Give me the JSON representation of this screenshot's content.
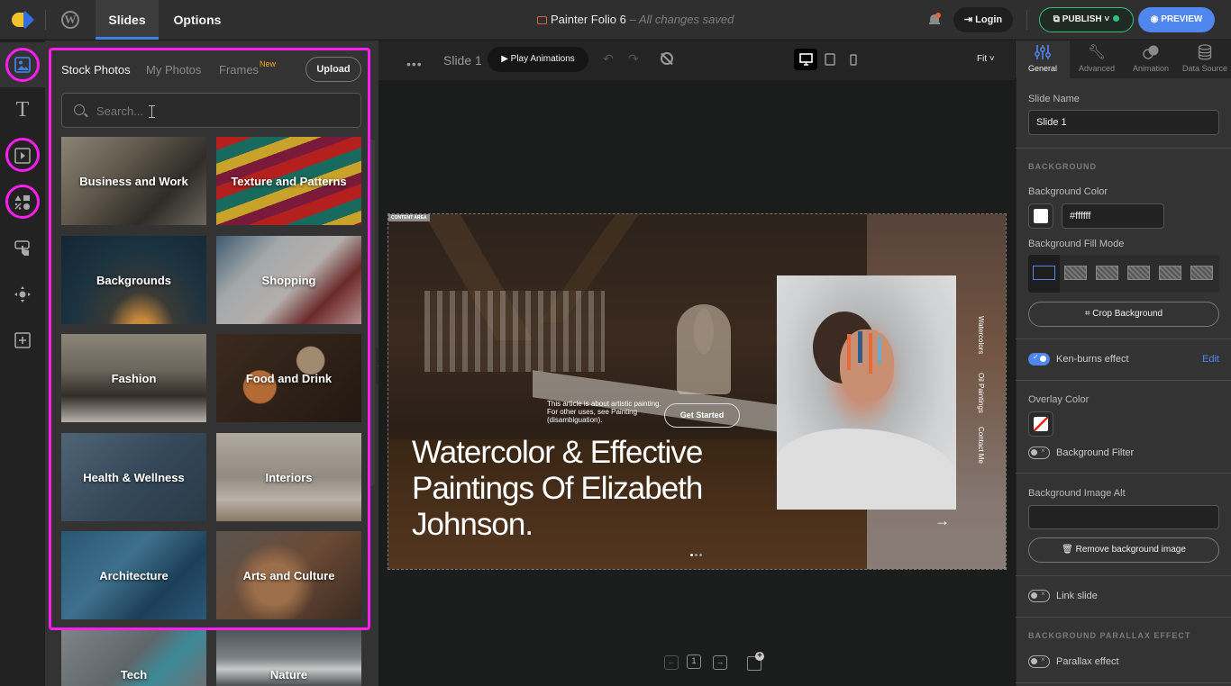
{
  "topbar": {
    "tabs": [
      {
        "label": "Slides",
        "active": true
      },
      {
        "label": "Options",
        "active": false
      }
    ],
    "project_title": "Painter Folio 6",
    "save_status": "– All changes saved",
    "login_label": "Login",
    "publish_label": "PUBLISH",
    "preview_label": "PREVIEW",
    "colors": {
      "accent": "#3f7ee8",
      "publish": "#2ec27e",
      "preview": "#4f86f0"
    }
  },
  "left_sidebar": {
    "items": [
      {
        "name": "images",
        "icon": "image-icon",
        "active": true,
        "highlighted": true
      },
      {
        "name": "text",
        "icon": "text-icon",
        "glyph": "T",
        "active": false,
        "highlighted": false
      },
      {
        "name": "video",
        "icon": "video-icon",
        "active": false,
        "highlighted": true
      },
      {
        "name": "shapes",
        "icon": "shapes-icon",
        "active": false,
        "highlighted": true
      },
      {
        "name": "interactive",
        "icon": "tap-icon",
        "active": false,
        "highlighted": false
      },
      {
        "name": "move",
        "icon": "move-icon",
        "active": false,
        "highlighted": false
      },
      {
        "name": "add",
        "icon": "add-icon",
        "active": false,
        "highlighted": false
      }
    ]
  },
  "photos_panel": {
    "tabs": [
      {
        "label": "Stock Photos",
        "active": true
      },
      {
        "label": "My Photos",
        "active": false
      },
      {
        "label": "Frames",
        "active": false,
        "badge": "New"
      }
    ],
    "upload_label": "Upload",
    "search": {
      "placeholder": "Search...",
      "value": ""
    },
    "categories": [
      {
        "label": "Business and Work"
      },
      {
        "label": "Texture and Patterns"
      },
      {
        "label": "Backgrounds"
      },
      {
        "label": "Shopping"
      },
      {
        "label": "Fashion"
      },
      {
        "label": "Food and Drink"
      },
      {
        "label": "Health & Wellness"
      },
      {
        "label": "Interiors"
      },
      {
        "label": "Architecture"
      },
      {
        "label": "Arts and Culture"
      },
      {
        "label": "Tech"
      },
      {
        "label": "Nature"
      }
    ]
  },
  "canvas_toolbar": {
    "more_icon": "more-icon",
    "slide_label": "Slide 1",
    "play_label": "Play Animations",
    "devices": [
      {
        "name": "desktop",
        "active": true
      },
      {
        "name": "tablet",
        "active": false
      },
      {
        "name": "mobile",
        "active": false
      }
    ],
    "zoom_label": "Fit"
  },
  "slide": {
    "content_area_label": "CONTENT AREA",
    "intro_text": "This article is about artistic painting. For other uses, see Painting (disambiguation).",
    "cta_label": "Get Started",
    "headline": "Watercolor & Effective Paintings Of Elizabeth Johnson.",
    "nav_links": [
      "Watercolors",
      "Oil Paintings",
      "Contact Me"
    ],
    "dots": {
      "count": 3,
      "active": 1
    }
  },
  "pager": {
    "current_page": "1"
  },
  "properties": {
    "tabs": [
      {
        "label": "General",
        "active": true
      },
      {
        "label": "Advanced",
        "active": false
      },
      {
        "label": "Animation",
        "active": false
      },
      {
        "label": "Data Source",
        "active": false
      }
    ],
    "slide_name_label": "Slide Name",
    "slide_name_value": "Slide 1",
    "background_section": "BACKGROUND",
    "bg_color_label": "Background Color",
    "bg_color_value": "#ffffff",
    "fill_mode_label": "Background Fill Mode",
    "fill_modes": [
      "crop",
      "fit-width",
      "fill",
      "center",
      "stretch",
      "tile"
    ],
    "fill_mode_selected": "crop",
    "crop_label": "Crop Background",
    "kenburns_label": "Ken-burns effect",
    "kenburns_on": true,
    "kenburns_edit": "Edit",
    "overlay_label": "Overlay Color",
    "bg_filter_label": "Background Filter",
    "bg_filter_on": false,
    "alt_label": "Background Image Alt",
    "alt_value": "",
    "remove_bg_label": "Remove background image",
    "link_slide_label": "Link slide",
    "link_slide_on": false,
    "parallax_section": "BACKGROUND PARALLAX EFFECT",
    "parallax_label": "Parallax effect",
    "parallax_on": false
  }
}
